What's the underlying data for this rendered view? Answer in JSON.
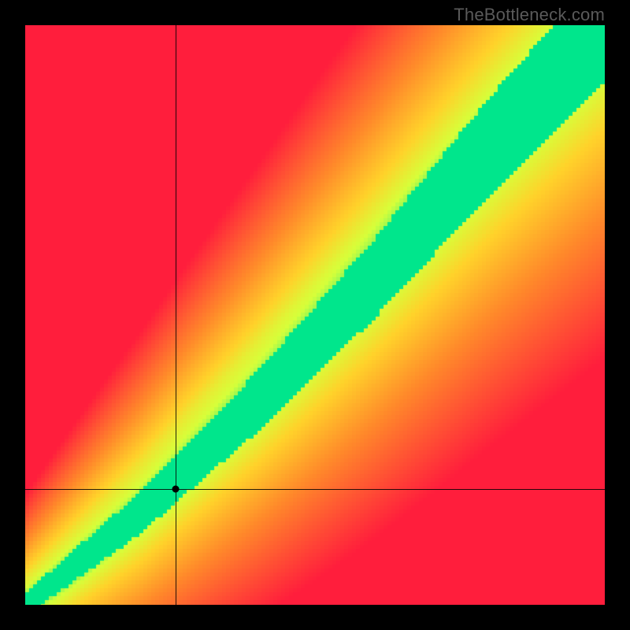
{
  "watermark": "TheBottleneck.com",
  "chart_data": {
    "type": "heatmap",
    "title": "",
    "xlabel": "",
    "ylabel": "",
    "xlim": [
      0,
      100
    ],
    "ylim": [
      0,
      100
    ],
    "crosshair": {
      "x": 26,
      "y": 20
    },
    "marker": {
      "x": 26,
      "y": 20
    },
    "optimal_band": {
      "description": "Green diagonal balance band where y grows slightly superlinearly with x; band widens toward top-right.",
      "center_line_points": [
        {
          "x": 0,
          "y": 0
        },
        {
          "x": 20,
          "y": 16
        },
        {
          "x": 40,
          "y": 35
        },
        {
          "x": 60,
          "y": 56
        },
        {
          "x": 80,
          "y": 79
        },
        {
          "x": 100,
          "y": 100
        }
      ],
      "band_half_width": {
        "at_x_0": 2,
        "at_x_100": 10
      }
    },
    "color_stops": [
      {
        "distance": 0.0,
        "color": "#00e68c"
      },
      {
        "distance": 0.12,
        "color": "#d6ff3a"
      },
      {
        "distance": 0.28,
        "color": "#ffd22a"
      },
      {
        "distance": 0.55,
        "color": "#ff8a2a"
      },
      {
        "distance": 1.0,
        "color": "#ff1e3c"
      }
    ],
    "legend": []
  }
}
